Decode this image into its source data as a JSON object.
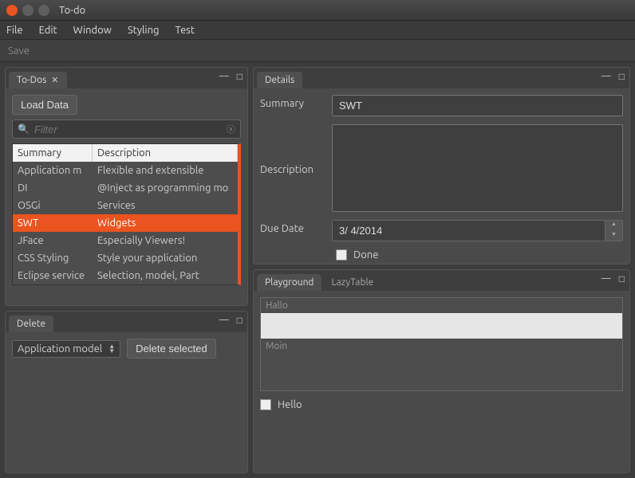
{
  "window": {
    "title": "To-do"
  },
  "menubar": [
    "File",
    "Edit",
    "Window",
    "Styling",
    "Test"
  ],
  "toolbar": {
    "save": "Save"
  },
  "panels": {
    "todos": {
      "tab": "To-Dos",
      "loadData": "Load Data",
      "filterPlaceholder": "Filter",
      "columns": {
        "summary": "Summary",
        "description": "Description"
      },
      "rows": [
        {
          "summary": "Application m",
          "description": "Flexible and extensible"
        },
        {
          "summary": "DI",
          "description": "@Inject as programming mo"
        },
        {
          "summary": "OSGi",
          "description": "Services"
        },
        {
          "summary": "SWT",
          "description": "Widgets"
        },
        {
          "summary": "JFace",
          "description": "Especially Viewers!"
        },
        {
          "summary": "CSS Styling",
          "description": "Style your application"
        },
        {
          "summary": "Eclipse service",
          "description": "Selection, model, Part"
        }
      ],
      "selectedIndex": 3
    },
    "delete": {
      "tab": "Delete",
      "spinnerValue": "Application model",
      "button": "Delete selected"
    },
    "details": {
      "tab": "Details",
      "labels": {
        "summary": "Summary",
        "description": "Description",
        "dueDate": "Due Date",
        "done": "Done"
      },
      "summaryValue": "SWT",
      "descriptionValue": "",
      "dueDateValue": "3/ 4/2014",
      "doneChecked": false
    },
    "playground": {
      "tabs": [
        "Playground",
        "LazyTable"
      ],
      "activeTab": 0,
      "listItems": [
        "Hallo",
        "",
        "Moin"
      ],
      "selectedListIndex": 1,
      "helloLabel": "Hello",
      "helloChecked": false
    }
  }
}
